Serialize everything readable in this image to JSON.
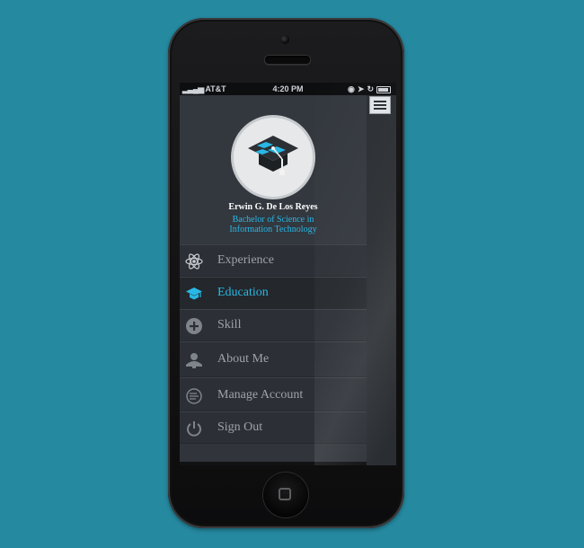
{
  "status_bar": {
    "carrier": "AT&T",
    "time": "4:20 PM"
  },
  "profile": {
    "name": "Erwin G. De Los Reyes",
    "degree_line1": "Bachelor of  Science in",
    "degree_line2": "Information Technology"
  },
  "menu": {
    "items": [
      {
        "label": "Experience",
        "icon": "atom-icon"
      },
      {
        "label": "Education",
        "icon": "graduation-cap-icon"
      },
      {
        "label": "Skill",
        "icon": "plus-circle-icon"
      },
      {
        "label": "About Me",
        "icon": "user-icon"
      },
      {
        "label": "Manage Account",
        "icon": "account-settings-icon"
      },
      {
        "label": "Sign Out",
        "icon": "power-icon"
      }
    ],
    "active_index": 1
  },
  "colors": {
    "background": "#2589a0",
    "accent": "#29b8e5",
    "drawer": "#31353b",
    "menu_text": "#9ea3a9"
  }
}
